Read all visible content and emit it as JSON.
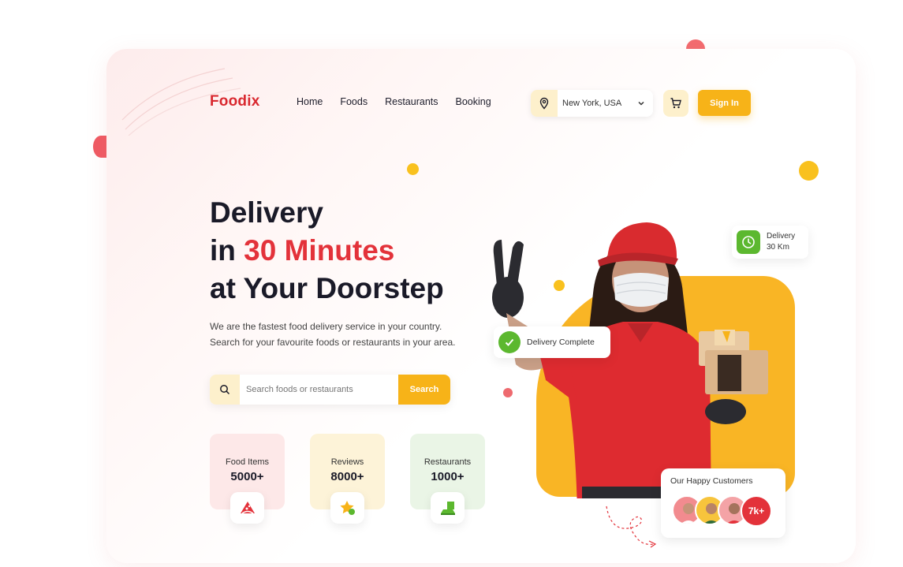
{
  "brand": {
    "logo": "Foodix",
    "accent": "#e3323a",
    "primary": "#f7b318"
  },
  "nav": [
    "Home",
    "Foods",
    "Restaurants",
    "Booking"
  ],
  "location": {
    "value": "New York, USA",
    "icon": "location-pin-icon"
  },
  "cart_icon": "cart-icon",
  "signin_label": "Sign In",
  "hero": {
    "line1": "Delivery",
    "line2_prefix": "in ",
    "line2_accent": "30 Minutes",
    "line3": "at Your Doorstep",
    "subtitle": "We are the fastest food delivery service in your country. Search for your favourite foods or restaurants in your area."
  },
  "search": {
    "placeholder": "Search foods or restaurants",
    "button": "Search"
  },
  "stats": [
    {
      "label": "Food Items",
      "value": "5000+",
      "icon": "pizza-icon",
      "bg": "#fde8e8"
    },
    {
      "label": "Reviews",
      "value": "8000+",
      "icon": "star-icon",
      "bg": "#fdf3d8"
    },
    {
      "label": "Restaurants",
      "value": "1000+",
      "icon": "restaurant-icon",
      "bg": "#eaf5e6"
    }
  ],
  "badges": {
    "delivery_time_line1": "Delivery",
    "delivery_time_line2": "30 Km",
    "delivery_complete": "Delivery Complete"
  },
  "customers": {
    "title": "Our Happy Customers",
    "count": "7k+"
  }
}
